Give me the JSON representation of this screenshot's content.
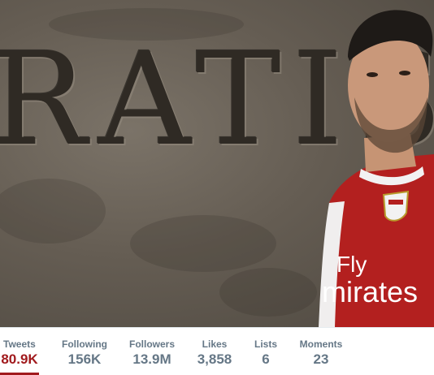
{
  "banner": {
    "carved_text": "RATIS",
    "shirt_sponsor_line1": "Fly",
    "shirt_sponsor_line2": "mirates"
  },
  "stats": [
    {
      "label": "Tweets",
      "value": "80.9K"
    },
    {
      "label": "Following",
      "value": "156K"
    },
    {
      "label": "Followers",
      "value": "13.9M"
    },
    {
      "label": "Likes",
      "value": "3,858"
    },
    {
      "label": "Lists",
      "value": "6"
    },
    {
      "label": "Moments",
      "value": "23"
    }
  ],
  "colors": {
    "accent": "#a11a1d",
    "label": "#657786",
    "active_value": "#14171a"
  }
}
